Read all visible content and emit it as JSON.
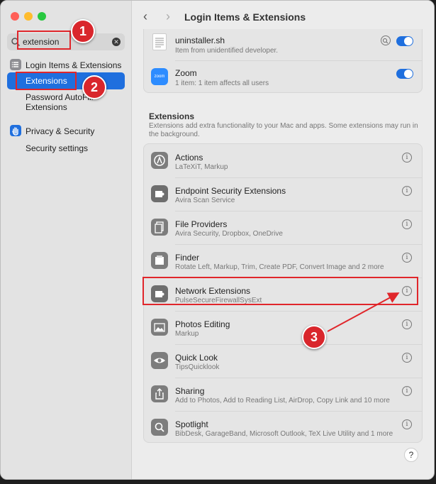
{
  "window": {
    "title": "Login Items & Extensions"
  },
  "sidebar": {
    "search_value": "extension",
    "items": [
      {
        "label": "Login Items & Extensions",
        "icon": "list-icon"
      },
      {
        "label": "Extensions",
        "selected": true
      },
      {
        "label": "Password AutoFill",
        "label2": "Extensions"
      },
      {
        "label": "Privacy & Security",
        "icon": "hand-icon"
      },
      {
        "label": "Security settings"
      }
    ]
  },
  "top_items": [
    {
      "name": "uninstaller.sh",
      "sub": "Item from unidentified developer.",
      "icon_text": ""
    },
    {
      "name": "Zoom",
      "sub": "1 item: 1 item affects all users",
      "icon_text": "zoom"
    }
  ],
  "extensions": {
    "title": "Extensions",
    "description": "Extensions add extra functionality to your Mac and apps. Some extensions may run in the background.",
    "rows": [
      {
        "name": "Actions",
        "sub": "LaTeXiT, Markup"
      },
      {
        "name": "Endpoint Security Extensions",
        "sub": "Avira Scan Service"
      },
      {
        "name": "File Providers",
        "sub": "Avira Security, Dropbox, OneDrive"
      },
      {
        "name": "Finder",
        "sub": "Rotate Left, Markup, Trim, Create PDF, Convert Image and 2 more"
      },
      {
        "name": "Network Extensions",
        "sub": "PulseSecureFirewallSysExt"
      },
      {
        "name": "Photos Editing",
        "sub": "Markup"
      },
      {
        "name": "Quick Look",
        "sub": "TipsQuicklook"
      },
      {
        "name": "Sharing",
        "sub": "Add to Photos, Add to Reading List, AirDrop, Copy Link and 10 more"
      },
      {
        "name": "Spotlight",
        "sub": "BibDesk, GarageBand, Microsoft Outlook, TeX Live Utility and 1 more"
      }
    ]
  },
  "annotations": {
    "badge1": "1",
    "badge2": "2",
    "badge3": "3"
  },
  "colors": {
    "accent": "#1f6fde",
    "annotation": "#d9262c"
  }
}
